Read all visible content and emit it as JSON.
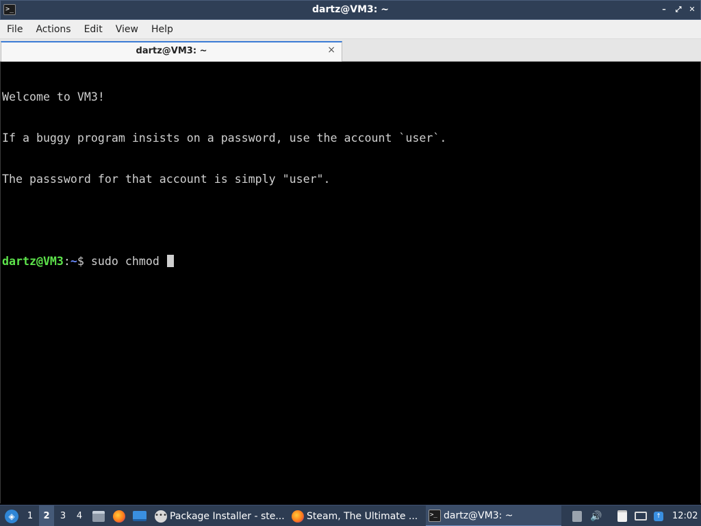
{
  "window": {
    "title": "dartz@VM3: ~",
    "app_icon_glyph": ">_",
    "buttons": {
      "minimize": "–",
      "maximize": "⤢",
      "close": "✕"
    }
  },
  "menubar": {
    "items": [
      "File",
      "Actions",
      "Edit",
      "View",
      "Help"
    ]
  },
  "tabs": [
    {
      "label": "dartz@VM3: ~",
      "close": "×"
    }
  ],
  "terminal": {
    "lines": [
      "Welcome to VM3!",
      "If a buggy program insists on a password, use the account `user`.",
      "The passsword for that account is simply \"user\".",
      ""
    ],
    "prompt": {
      "user_host": "dartz@VM3",
      "colon": ":",
      "path": "~",
      "symbol": "$ ",
      "command": "sudo chmod "
    },
    "colors": {
      "user_host": "#5de34b",
      "path": "#6b8cff",
      "text": "#d0d0d0"
    }
  },
  "taskbar": {
    "workspaces": [
      "1",
      "2",
      "3",
      "4"
    ],
    "active_workspace": "2",
    "quick_launch": [
      "file-manager-icon",
      "firefox-icon",
      "show-desktop-icon"
    ],
    "tasks": [
      {
        "label": "Package Installer - ste...",
        "icon": "package-installer-icon",
        "active": false
      },
      {
        "label": "Steam, The Ultimate ...",
        "icon": "firefox-icon",
        "active": false
      },
      {
        "label": "dartz@VM3: ~",
        "icon": "terminal-icon",
        "active": true
      }
    ],
    "tray": [
      "storage-icon",
      "volume-icon",
      "clipboard-icon",
      "network-icon",
      "update-icon"
    ],
    "clock": "12:02"
  }
}
